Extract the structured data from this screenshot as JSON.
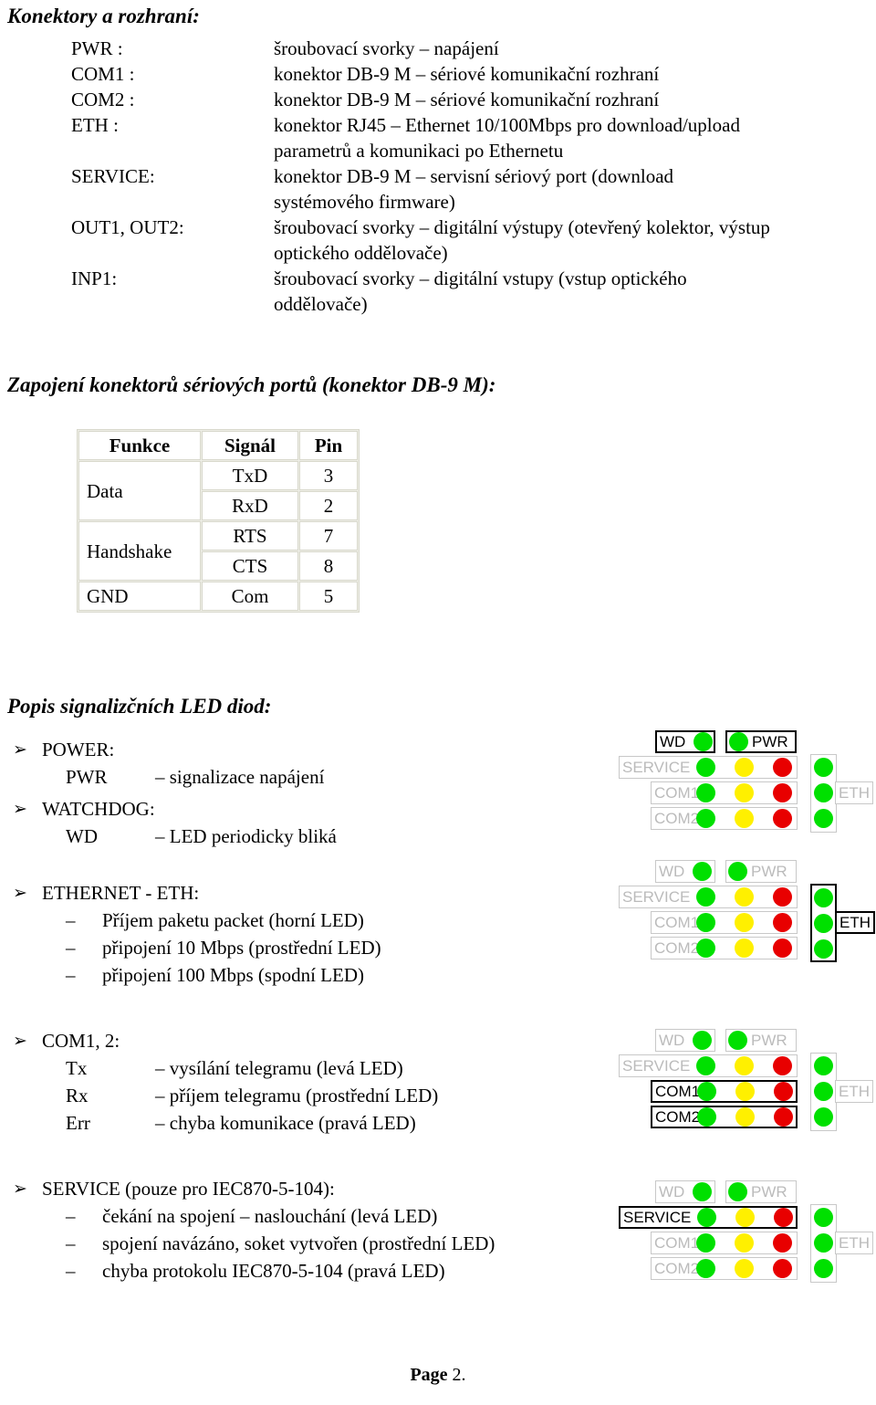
{
  "document": {
    "footer_word": "Page",
    "footer_number": " 2."
  },
  "connectors": {
    "heading": "Konektory a rozhraní:",
    "rows": [
      {
        "term": "PWR :",
        "desc": "šroubovací svorky – napájení",
        "desc2": ""
      },
      {
        "term": "COM1 :",
        "desc": "konektor DB-9 M – sériové komunikační rozhraní",
        "desc2": ""
      },
      {
        "term": "COM2 :",
        "desc": "konektor DB-9 M – sériové komunikační rozhraní",
        "desc2": ""
      },
      {
        "term": "ETH :",
        "desc": "konektor RJ45 – Ethernet 10/100Mbps pro download/upload",
        "desc2": "parametrů a komunikaci po Ethernetu"
      },
      {
        "term": "SERVICE:",
        "desc": "konektor DB-9 M – servisní sériový port (download",
        "desc2": "systémového firmware)"
      },
      {
        "term": "OUT1, OUT2:",
        "desc": "šroubovací svorky – digitální výstupy (otevřený kolektor, výstup",
        "desc2": "optického oddělovače)"
      },
      {
        "term": "INP1:",
        "desc": "šroubovací svorky – digitální vstupy (vstup optického",
        "desc2": "oddělovače)"
      }
    ]
  },
  "pinout": {
    "heading": "Zapojení konektorů sériových portů (konektor DB-9 M):",
    "columns": [
      "Funkce",
      "Signál",
      "Pin"
    ],
    "rows": [
      {
        "funkce": "Data",
        "signal": "TxD",
        "pin": "3"
      },
      {
        "funkce": "",
        "signal": "RxD",
        "pin": "2"
      },
      {
        "funkce": "Handshake",
        "signal": "RTS",
        "pin": "7"
      },
      {
        "funkce": "",
        "signal": "CTS",
        "pin": "8"
      },
      {
        "funkce": "GND",
        "signal": "Com",
        "pin": "5"
      }
    ]
  },
  "leds": {
    "heading": "Popis signalizčních LED diod:",
    "bullet_glyph": "➢",
    "dash_glyph": "–",
    "groups": [
      {
        "title": "POWER:",
        "items": [
          {
            "name": "PWR",
            "dash": "–",
            "desc": "signalizace napájení"
          }
        ]
      },
      {
        "title": "WATCHDOG:",
        "items": [
          {
            "name": "WD",
            "dash": "–",
            "desc": "LED periodicky bliká"
          }
        ]
      },
      {
        "title": "ETHERNET - ETH:",
        "items": [
          {
            "name": "",
            "dash": "–",
            "desc": "Příjem paketu packet (horní LED)"
          },
          {
            "name": "",
            "dash": "–",
            "desc": "připojení 10 Mbps (prostřední LED)"
          },
          {
            "name": "",
            "dash": "–",
            "desc": "připojení 100 Mbps (spodní LED)"
          }
        ]
      },
      {
        "title": "COM1, 2:",
        "items": [
          {
            "name": "Tx",
            "dash": "–",
            "desc": "vysílání telegramu (levá LED)"
          },
          {
            "name": "Rx",
            "dash": "–",
            "desc": "příjem telegramu (prostřední LED)"
          },
          {
            "name": "Err",
            "dash": "–",
            "desc": "chyba komunikace (pravá LED)"
          }
        ]
      },
      {
        "title": "SERVICE (pouze pro IEC870-5-104):",
        "items": [
          {
            "name": "",
            "dash": "–",
            "desc": "čekání na spojení – naslouchání (levá LED)"
          },
          {
            "name": "",
            "dash": "–",
            "desc": "spojení navázáno, soket vytvořen (prostřední LED)"
          },
          {
            "name": "",
            "dash": "–",
            "desc": "chyba protokolu IEC870-5-104  (pravá LED)"
          }
        ]
      }
    ]
  },
  "panel_labels": {
    "wd": "WD",
    "pwr": "PWR",
    "service": "SERVICE",
    "com1": "COM1",
    "com2": "COM2",
    "eth": "ETH"
  },
  "panel_colors": {
    "green": "#00e000",
    "yellow": "#fff000",
    "red": "#e80000",
    "idle_outline": "#c8c8c8",
    "idle_text": "#bbbbbb",
    "active_outline": "#000000"
  },
  "panels": [
    {
      "id": "panel-power-watchdog",
      "highlight": [
        "wd",
        "pwr"
      ]
    },
    {
      "id": "panel-ethernet",
      "highlight": [
        "eth"
      ]
    },
    {
      "id": "panel-com",
      "highlight": [
        "com1",
        "com2"
      ]
    },
    {
      "id": "panel-service",
      "highlight": [
        "service"
      ]
    }
  ]
}
